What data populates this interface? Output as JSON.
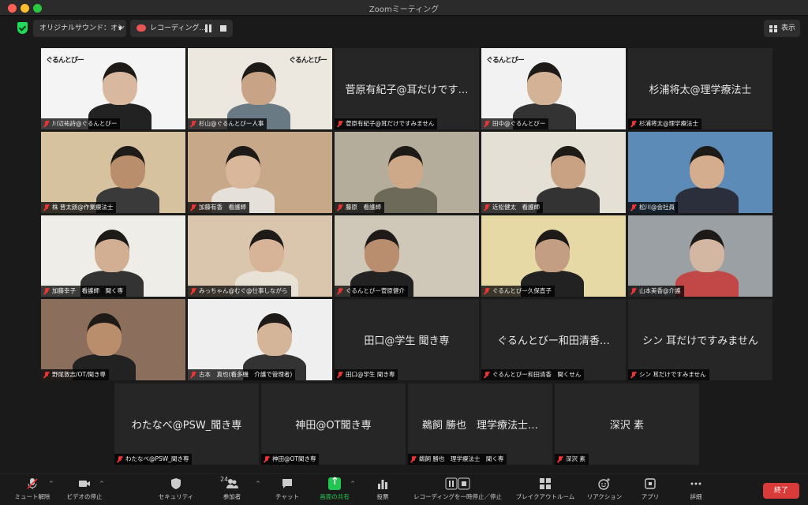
{
  "window": {
    "title": "Zoomミーティング"
  },
  "topbar": {
    "audio_label": "オリジナルサウンド：オン",
    "recording_label": "レコーディング...",
    "view_label": "表示"
  },
  "tiles": [
    {
      "name": "川辺祐詩@ぐるんとびー",
      "center": "",
      "logo": "ぐるんとびー"
    },
    {
      "name": "杉山@ぐるんとびー人事",
      "center": "",
      "logo": "ぐるんとびー"
    },
    {
      "name": "菅原有紀子@耳だけですみません",
      "center": "菅原有紀子@耳だけです…"
    },
    {
      "name": "田中@ぐるんとびー",
      "center": "",
      "logo": "ぐるんとびー"
    },
    {
      "name": "杉浦将太@理学療法士",
      "center": "杉浦将太@理学療法士"
    },
    {
      "name": "株 晋太朗@作業療法士",
      "center": ""
    },
    {
      "name": "加藤有香　看護師",
      "center": ""
    },
    {
      "name": "藤原　看護師",
      "center": ""
    },
    {
      "name": "近松健太　看護師",
      "center": ""
    },
    {
      "name": "松川@会社員",
      "center": ""
    },
    {
      "name": "加藤幸子　看護師　聞く専",
      "center": ""
    },
    {
      "name": "みっちゃん@むぐ@仕事しながら",
      "center": ""
    },
    {
      "name": "ぐるんとびー菅原健介",
      "center": ""
    },
    {
      "name": "ぐるんとびー久保直子",
      "center": ""
    },
    {
      "name": "山本美香@介護",
      "center": ""
    },
    {
      "name": "野尾敦志/OT/聞き専",
      "center": ""
    },
    {
      "name": "古本　真也(看多機　介護で管理者)",
      "center": ""
    },
    {
      "name": "田口@学生 聞き専",
      "center": "田口@学生 聞き専"
    },
    {
      "name": "ぐるんとびー和田清香　聞くせん",
      "center": "ぐるんとびー和田清香…"
    },
    {
      "name": "シン 耳だけですみません",
      "center": "シン 耳だけですみません"
    },
    {
      "name": "わたなべ@PSW_聞き専",
      "center": "わたなべ@PSW_聞き専"
    },
    {
      "name": "神田@OT聞き専",
      "center": "神田@OT聞き専"
    },
    {
      "name": "鵜飼 勝也　理学療法士　聞く専",
      "center": "鵜飼 勝也　理学療法士…"
    },
    {
      "name": "深沢 素",
      "center": "深沢 素"
    }
  ],
  "toolbar": {
    "mute": "ミュート解除",
    "video": "ビデオの停止",
    "security": "セキュリティ",
    "participants": "参加者",
    "participants_count": "24",
    "chat": "チャット",
    "share": "画面の共有",
    "polls": "投票",
    "recording": "レコーディングを一時停止／停止",
    "breakout": "ブレイクアウトルーム",
    "reactions": "リアクション",
    "apps": "アプリ",
    "more": "詳細",
    "end": "終了"
  },
  "colors": {
    "accent_green": "#23c552",
    "end_red": "#d93a3a",
    "active_speaker": "#c9e265"
  }
}
